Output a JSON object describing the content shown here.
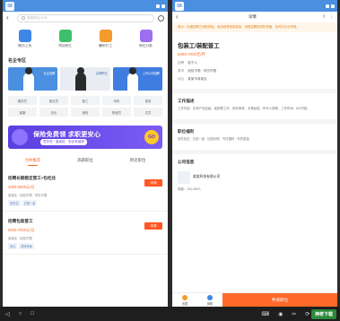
{
  "left": {
    "status_logo": "58",
    "search_placeholder": "搜索职位/公司",
    "quick": [
      {
        "label": "简历/上传",
        "color": "#3f86e6"
      },
      {
        "label": "附近职位",
        "color": "#3fbf6b"
      },
      {
        "label": "兼职/打工",
        "color": "#f39b2b"
      },
      {
        "label": "职位分类",
        "color": "#9e6ef1"
      }
    ],
    "section_title": "名企专区",
    "banners": [
      {
        "tag": "名企招聘",
        "color": "#4a8fe0"
      },
      {
        "tag": "高薪职位",
        "color": "#ffffff"
      },
      {
        "tag": "上市公司招聘",
        "color": "#3f7ee0"
      }
    ],
    "categories": [
      "服务员",
      "营业员",
      "普工",
      "司机",
      "保安",
      "客服",
      "店长",
      "销售",
      "快递员",
      "文员"
    ],
    "promo": {
      "title": "保险免费领 求职更安心",
      "sub": "意外险 · 重疾险 · 安全有保障",
      "go": "GO"
    },
    "tabs": [
      "为你推荐",
      "高薪职位",
      "附近职位"
    ],
    "jobs": [
      {
        "title": "招聘长期稳定普工+包吃住",
        "salary": "4000-6000元/月",
        "meta": "某某区 · 经验不限 · 学历不限",
        "tags": [
          "包吃住",
          "五险一金"
        ],
        "apply": "申请"
      },
      {
        "title": "招聘包装普工",
        "salary": "5000-7000元/月",
        "meta": "某某区 · 经验不限",
        "tags": [
          "包住",
          "周末双休"
        ],
        "apply": "申请"
      }
    ]
  },
  "right": {
    "status_logo": "58",
    "header_title": "详情",
    "notice": "提示：如遇招聘方收取押金、培训费等各类费用，请提高警惕谨防受骗，及时向平台举报。",
    "job_name": "包装工/装配普工",
    "salary": "5000-7000元/月",
    "info": [
      {
        "label": "招聘",
        "value": "若干人"
      },
      {
        "label": "要求",
        "value": "经验不限 · 学历不限"
      },
      {
        "label": "地址",
        "value": "某某市某某区"
      }
    ],
    "desc_title": "工作描述",
    "desc": "工作内容：负责产品包装、装配等工作，操作简单，无需经验，有专人带教。工作时间：8小时制。",
    "benefit_title": "职位福利",
    "benefit_text": "包吃包住 · 五险一金 · 加班补助 · 节日福利 · 年终奖金",
    "company_title": "公司信息",
    "company_name": "某某科技有限公司",
    "company_size": "规模：100-499人",
    "bottom": {
      "fav": "收藏",
      "chat": "微聊",
      "apply": "申请职位"
    }
  },
  "emulator": {
    "watermark": "神奇下载"
  }
}
